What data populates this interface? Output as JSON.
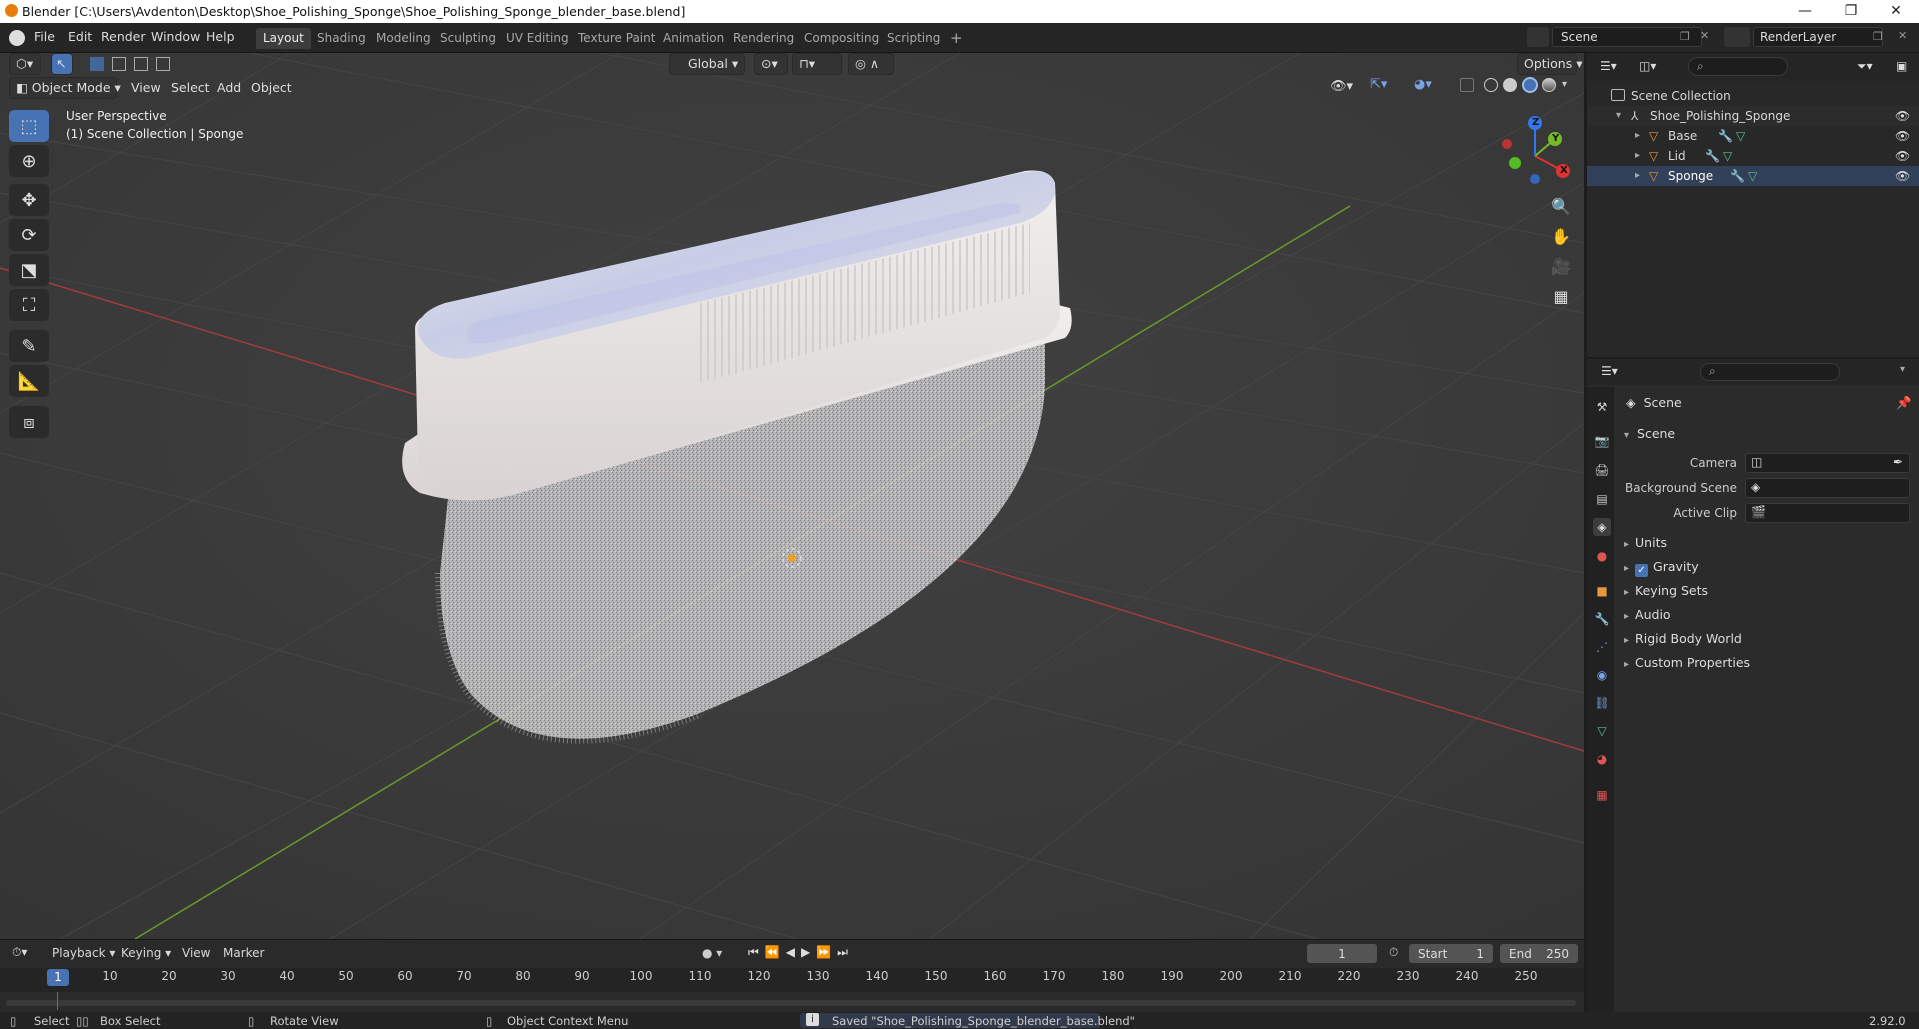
{
  "titlebar": {
    "title": "Blender [C:\\Users\\Avdenton\\Desktop\\Shoe_Polishing_Sponge\\Shoe_Polishing_Sponge_blender_base.blend]",
    "min": "—",
    "max": "❐",
    "close": "✕"
  },
  "menu": [
    "File",
    "Edit",
    "Render",
    "Window",
    "Help"
  ],
  "workspaces": [
    "Layout",
    "Shading",
    "Modeling",
    "Sculpting",
    "UV Editing",
    "Texture Paint",
    "Animation",
    "Rendering",
    "Compositing",
    "Scripting"
  ],
  "workspace_add": "+",
  "scene_selector": {
    "value": "Scene"
  },
  "view_layer": {
    "value": "RenderLayer"
  },
  "viewport": {
    "transform_orientation": "Global",
    "options_label": "Options",
    "mode": "Object Mode",
    "menus": [
      "View",
      "Select",
      "Add",
      "Object"
    ],
    "overlay_line1": "User Perspective",
    "overlay_line2": "(1) Scene Collection | Sponge",
    "gizmo": {
      "x": "X",
      "y": "Y",
      "z": "Z"
    }
  },
  "tools": [
    "select-box",
    "cursor",
    "move",
    "rotate",
    "scale",
    "transform",
    "annotate",
    "measure",
    "add-cube"
  ],
  "outliner": {
    "root": "Scene Collection",
    "collection": "Shoe_Polishing_Sponge",
    "objects": [
      {
        "name": "Base"
      },
      {
        "name": "Lid"
      },
      {
        "name": "Sponge"
      }
    ]
  },
  "properties": {
    "header_title": "Scene",
    "panel_title": "Scene",
    "fields": [
      {
        "label": "Camera"
      },
      {
        "label": "Background Scene"
      },
      {
        "label": "Active Clip"
      }
    ],
    "subpanels": [
      "Units",
      "Gravity",
      "Keying Sets",
      "Audio",
      "Rigid Body World",
      "Custom Properties"
    ],
    "gravity_checked": true
  },
  "timeline": {
    "menus": [
      "Playback",
      "Keying",
      "View",
      "Marker"
    ],
    "current_frame": "1",
    "start_label": "Start",
    "start": "1",
    "end_label": "End",
    "end": "250",
    "ruler": [
      "10",
      "20",
      "30",
      "40",
      "50",
      "60",
      "70",
      "80",
      "90",
      "100",
      "110",
      "120",
      "130",
      "140",
      "150",
      "160",
      "170",
      "180",
      "190",
      "200",
      "210",
      "220",
      "230",
      "240",
      "250"
    ],
    "frame_marker": "1"
  },
  "status": {
    "select": "Select",
    "box_select": "Box Select",
    "rotate_view": "Rotate View",
    "context_menu": "Object Context Menu",
    "message": "Saved \"Shoe_Polishing_Sponge_blender_base.blend\"",
    "version": "2.92.0"
  },
  "colors": {
    "accent": "#4772b3",
    "x_axis": "#a23b3b",
    "y_axis": "#6a9a2a",
    "grid": "#474747"
  }
}
